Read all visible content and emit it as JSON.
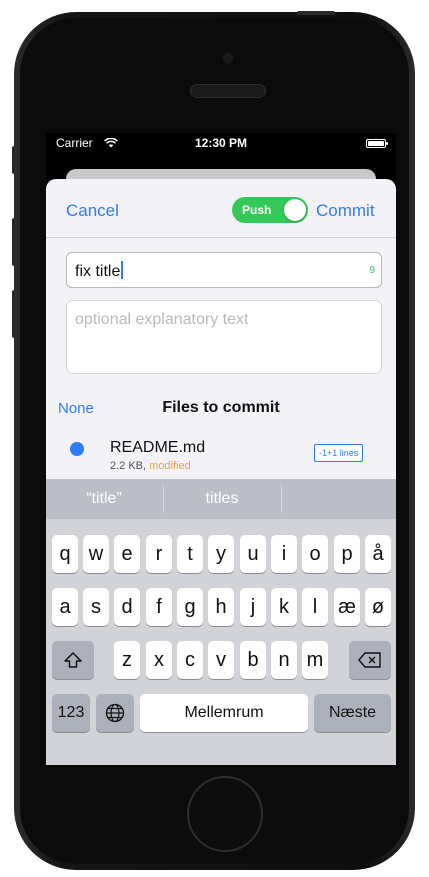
{
  "status_bar": {
    "carrier": "Carrier",
    "time": "12:30 PM"
  },
  "nav": {
    "cancel_label": "Cancel",
    "push_label": "Push",
    "push_on": true,
    "commit_label": "Commit"
  },
  "title_field": {
    "value": "fix title",
    "count": "9"
  },
  "message_field": {
    "placeholder": "optional explanatory text"
  },
  "files": {
    "none_label": "None",
    "header": "Files to commit",
    "items": [
      {
        "name": "README.md",
        "size": "2.2 KB",
        "status": "modified",
        "diff": "-1+1 lines"
      }
    ]
  },
  "keyboard": {
    "suggestions": [
      "“title”",
      "titles",
      ""
    ],
    "row1": [
      "q",
      "w",
      "e",
      "r",
      "t",
      "y",
      "u",
      "i",
      "o",
      "p",
      "å"
    ],
    "row2": [
      "a",
      "s",
      "d",
      "f",
      "g",
      "h",
      "j",
      "k",
      "l",
      "æ",
      "ø"
    ],
    "row3": [
      "z",
      "x",
      "c",
      "v",
      "b",
      "n",
      "m"
    ],
    "numbers_label": "123",
    "space_label": "Mellemrum",
    "return_label": "Næste"
  },
  "colors": {
    "accent": "#2f7cf6",
    "toggle_on": "#34c759",
    "modified": "#f0a23a"
  }
}
